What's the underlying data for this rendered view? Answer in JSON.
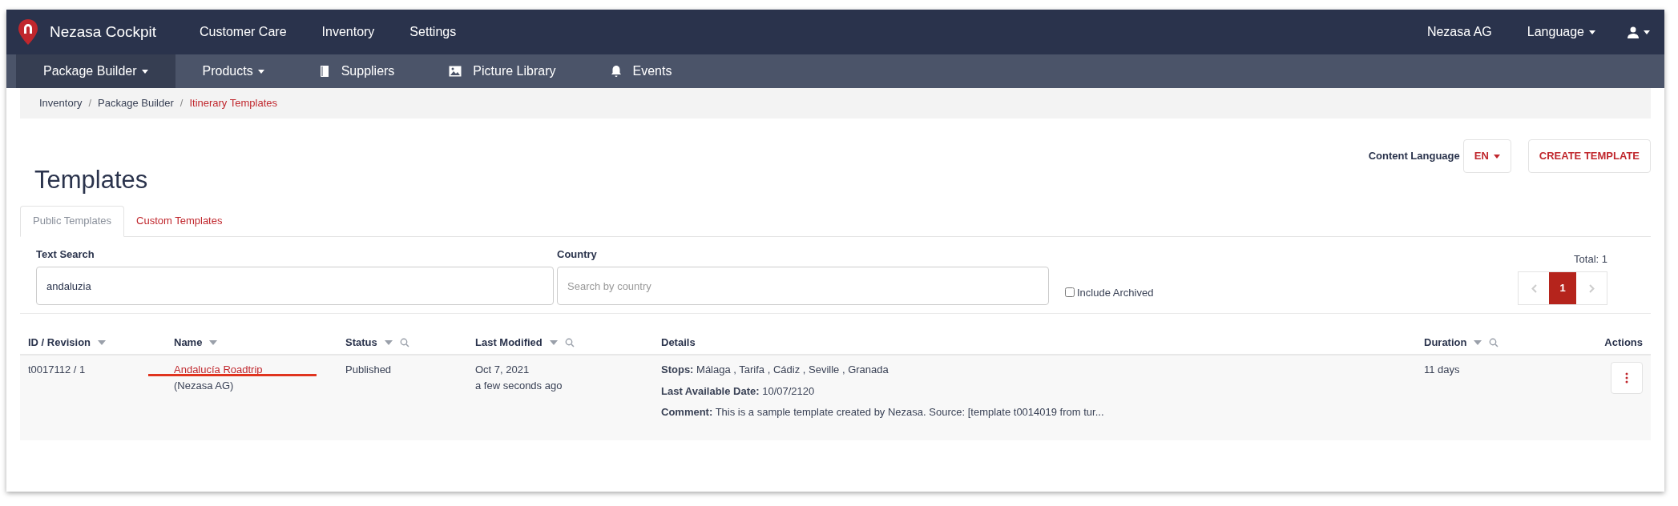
{
  "top_nav": {
    "brand": "Nezasa Cockpit",
    "items": [
      "Customer Care",
      "Inventory",
      "Settings"
    ],
    "organization": "Nezasa AG",
    "language": "Language"
  },
  "sub_nav": [
    {
      "label": "Package Builder",
      "kind": "menu",
      "dropdown": true,
      "selected": true
    },
    {
      "label": "Products",
      "kind": "menu",
      "dropdown": true,
      "selected": false
    },
    {
      "label": "Suppliers",
      "kind": "book",
      "dropdown": false,
      "selected": false
    },
    {
      "label": "Picture Library",
      "kind": "picture",
      "dropdown": false,
      "selected": false
    },
    {
      "label": "Events",
      "kind": "bell",
      "dropdown": false,
      "selected": false
    }
  ],
  "breadcrumb_separator": "/",
  "breadcrumb": [
    {
      "label": "Inventory",
      "selected": false
    },
    {
      "label": "Package Builder",
      "selected": false
    },
    {
      "label": "Itinerary Templates",
      "selected": true
    }
  ],
  "header": {
    "title": "Templates",
    "content_language_label": "Content Language",
    "language_button": "EN",
    "create_button": "CREATE TEMPLATE"
  },
  "tabs": [
    {
      "label": "Public Templates",
      "selected": true
    },
    {
      "label": "Custom Templates",
      "selected": false
    }
  ],
  "filters": {
    "text_search": {
      "label": "Text Search",
      "value": "andaluzia"
    },
    "country": {
      "label": "Country",
      "placeholder": "Search by country"
    },
    "include_archived": {
      "label": "Include Archived",
      "checked": false
    },
    "total": "Total: 1",
    "pages": [
      {
        "label": "1",
        "selected": true
      }
    ]
  },
  "table": {
    "columns": [
      {
        "label": "ID / Revision",
        "sortable": true,
        "searchable": false
      },
      {
        "label": "Name",
        "sortable": true,
        "searchable": false
      },
      {
        "label": "Status",
        "sortable": true,
        "searchable": true
      },
      {
        "label": "Last Modified",
        "sortable": true,
        "searchable": true
      },
      {
        "label": "Details",
        "sortable": false,
        "searchable": false
      },
      {
        "label": "Duration",
        "sortable": true,
        "searchable": true
      },
      {
        "label": "Actions",
        "sortable": false,
        "searchable": false
      }
    ],
    "rows": [
      {
        "id": "t0017112 / 1",
        "name": "Andalucía Roadtrip",
        "owner": "(Nezasa AG)",
        "status": "Published",
        "date": "Oct 7, 2021",
        "ago": "a few seconds ago",
        "details": [
          "**Stops:** Málaga , Tarifa , Cádiz , Seville , Granada",
          "**Last Available Date:** 10/07/2120",
          "**Comment:** This is a sample template created by Nezasa. Source: [template t0014019 from tur..."
        ],
        "duration": "11 days"
      }
    ]
  }
}
